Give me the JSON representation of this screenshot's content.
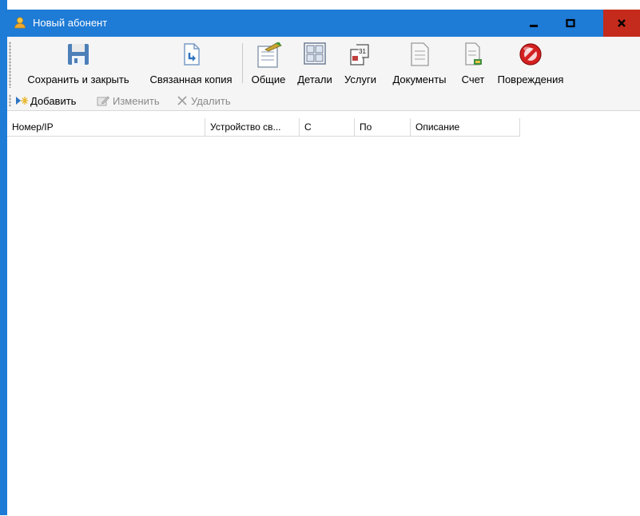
{
  "window": {
    "title": "Новый абонент",
    "frame_color": "#1e7bd6",
    "close_color": "#c42b1c"
  },
  "toolbar": {
    "items": [
      {
        "label": "Сохранить и закрыть",
        "icon": "floppy-disk-icon"
      },
      {
        "label": "Связанная копия",
        "icon": "document-copy-icon"
      },
      {
        "label": "Общие",
        "icon": "notepad-pen-icon"
      },
      {
        "label": "Детали",
        "icon": "details-grid-icon"
      },
      {
        "label": "Услуги",
        "icon": "calendar-services-icon"
      },
      {
        "label": "Документы",
        "icon": "document-icon"
      },
      {
        "label": "Счет",
        "icon": "invoice-icon"
      },
      {
        "label": "Повреждения",
        "icon": "no-entry-icon"
      }
    ]
  },
  "actions": {
    "add": "Добавить",
    "edit": "Изменить",
    "delete": "Удалить"
  },
  "grid": {
    "columns": [
      "Номер/IP",
      "Устройство св...",
      "С",
      "По",
      "Описание"
    ],
    "rows": []
  }
}
